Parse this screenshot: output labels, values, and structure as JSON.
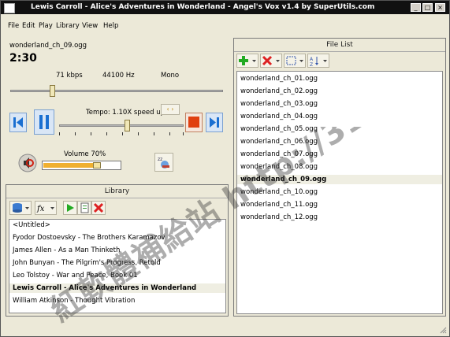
{
  "window": {
    "title": "Lewis Carroll - Alice's Adventures in Wonderland - Angel's Vox v1.4 by SuperUtils.com",
    "controls": [
      "_",
      "□",
      "×"
    ]
  },
  "menu": {
    "items": [
      {
        "label": "File"
      },
      {
        "label": "Edit"
      },
      {
        "label": "Play"
      },
      {
        "label": "Library"
      },
      {
        "label": "View"
      },
      {
        "label": "Help"
      }
    ]
  },
  "player": {
    "filename": "wonderland_ch_09.ogg",
    "time": "2:30",
    "bitrate": "71 kbps",
    "samplerate": "44100 Hz",
    "channels": "Mono",
    "position_fraction": 0.19,
    "tempo_label": "Tempo: 1.10X speed up",
    "tempo_fraction": 0.55,
    "volume_label": "Volume 70%",
    "volume_fraction": 0.7
  },
  "library": {
    "title": "Library",
    "items": [
      {
        "label": "<Untitled>"
      },
      {
        "label": "Fyodor Dostoevsky - The Brothers Karamazov"
      },
      {
        "label": "James Allen - As a Man Thinketh"
      },
      {
        "label": "John Bunyan - The Pilgrim's Progress, Retold"
      },
      {
        "label": "Leo Tolstoy - War and Peace, Book 01"
      },
      {
        "label": "Lewis Carroll - Alice's Adventures in Wonderland"
      },
      {
        "label": "William Atkinson - Thought Vibration"
      }
    ],
    "selected_index": 5
  },
  "filelist": {
    "title": "File List",
    "items": [
      {
        "label": "wonderland_ch_01.ogg"
      },
      {
        "label": "wonderland_ch_02.ogg"
      },
      {
        "label": "wonderland_ch_03.ogg"
      },
      {
        "label": "wonderland_ch_04.ogg"
      },
      {
        "label": "wonderland_ch_05.ogg"
      },
      {
        "label": "wonderland_ch_06.ogg"
      },
      {
        "label": "wonderland_ch_07.ogg"
      },
      {
        "label": "wonderland_ch_08.ogg"
      },
      {
        "label": "wonderland_ch_09.ogg"
      },
      {
        "label": "wonderland_ch_10.ogg"
      },
      {
        "label": "wonderland_ch_11.ogg"
      },
      {
        "label": "wonderland_ch_12.ogg"
      }
    ],
    "selected_index": 8
  },
  "watermark": {
    "text": "紅軟體補給站 http://31.to"
  },
  "colors": {
    "titlebar": "#111111",
    "accent_blue": "#1a6fd1",
    "stop_red": "#e04010",
    "add_green": "#22aa22",
    "delete_red": "#dd2222"
  }
}
